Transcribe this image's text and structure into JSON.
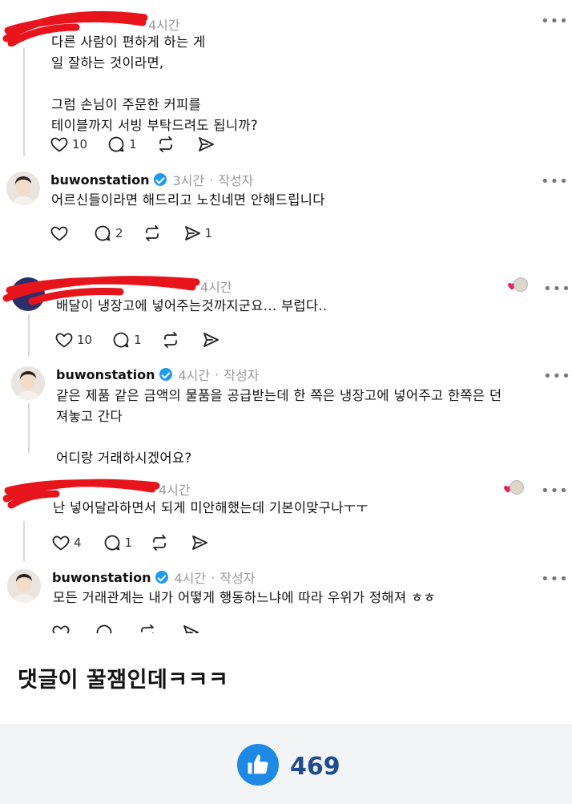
{
  "comments": [
    {
      "username": "",
      "time": "4시간",
      "author_tag": "",
      "text": "다른 사람이 편하게 하는 게\n일 잘하는 것이라면,\n\n그럼 손님이 주문한 커피를\n테이블까지 서빙 부탁드려도 됩니까?",
      "likes": "10",
      "replies": "1",
      "reposts": "",
      "shares": ""
    },
    {
      "username": "buwonstation",
      "time": "3시간",
      "author_tag": "작성자",
      "text": "어르신들이라면 해드리고 노친네면 안해드립니다",
      "likes": "",
      "replies": "2",
      "reposts": "",
      "shares": "1"
    },
    {
      "username": "",
      "time": "4시간",
      "author_tag": "",
      "text": "배달이 냉장고에 넣어주는것까지군요... 부럽다..",
      "likes": "10",
      "replies": "1",
      "reposts": "",
      "shares": ""
    },
    {
      "username": "buwonstation",
      "time": "4시간",
      "author_tag": "작성자",
      "text": "같은 제품 같은 금액의 물품을 공급받는데 한 쪽은 냉장고에 넣어주고 한쪽은 던\n져놓고 간다\n\n어디랑 거래하시겠어요?",
      "likes": "",
      "replies": "",
      "reposts": "",
      "shares": ""
    },
    {
      "username": "",
      "time": "4시간",
      "author_tag": "",
      "text": "난 넣어달라하면서 되게 미안해했는데 기본이맞구나ㅜㅜ",
      "likes": "4",
      "replies": "1",
      "reposts": "",
      "shares": ""
    },
    {
      "username": "buwonstation",
      "time": "4시간",
      "author_tag": "작성자",
      "text": "모든 거래관계는 내가 어떻게 행동하느냐에 따라 우위가 정해져 ㅎㅎ",
      "likes": "",
      "replies": "",
      "reposts": "",
      "shares": ""
    }
  ],
  "more_label": "•••",
  "dot_separator": "·",
  "caption": "댓글이 꿀잼인데ㅋㅋㅋ",
  "footer": {
    "like_count": "469"
  },
  "colors": {
    "accent": "#1e88e5",
    "verified": "#1d9bf0",
    "redaction": "#e8141c",
    "heart": "#e0245e"
  },
  "icons": [
    "heart-icon",
    "comment-icon",
    "repost-icon",
    "share-icon",
    "more-icon",
    "verified-icon",
    "thumbs-up-icon"
  ]
}
